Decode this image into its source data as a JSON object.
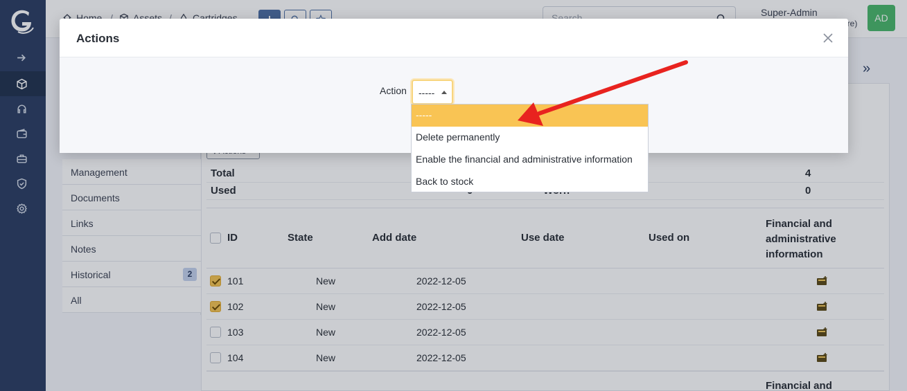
{
  "breadcrumb": {
    "home": "Home",
    "assets": "Assets",
    "cartridges": "Cartridges"
  },
  "search": {
    "placeholder": "Search"
  },
  "user": {
    "name": "Super-Admin",
    "entity": "ure)",
    "initials": "AD"
  },
  "tabs": [
    {
      "label": "Management"
    },
    {
      "label": "Documents"
    },
    {
      "label": "Links"
    },
    {
      "label": "Notes"
    },
    {
      "label": "Historical",
      "badge": "2"
    },
    {
      "label": "All"
    }
  ],
  "panel": {
    "actions_button": "Actions",
    "stats": [
      {
        "label": "Total",
        "mid": "",
        "right_label": "",
        "value": "4"
      },
      {
        "label": "Used",
        "mid": "0",
        "right_label": "Worn",
        "value": "0"
      }
    ],
    "table": {
      "headers": {
        "id": "ID",
        "state": "State",
        "add_date": "Add date",
        "use_date": "Use date",
        "used_on": "Used on",
        "financial": "Financial and administrative information"
      },
      "rows": [
        {
          "id": "101",
          "state": "New",
          "add_date": "2022-12-05",
          "checked": true
        },
        {
          "id": "102",
          "state": "New",
          "add_date": "2022-12-05",
          "checked": true
        },
        {
          "id": "103",
          "state": "New",
          "add_date": "2022-12-05",
          "checked": false
        },
        {
          "id": "104",
          "state": "New",
          "add_date": "2022-12-05",
          "checked": false
        }
      ],
      "footer_header": "Financial and"
    }
  },
  "modal": {
    "title": "Actions",
    "action_label": "Action",
    "selected_value": "-----",
    "options": [
      "-----",
      "Delete permanently",
      "Enable the financial and administrative information",
      "Back to stock"
    ]
  },
  "colors": {
    "sidebar": "#2c3e63",
    "accent": "#f9c454",
    "arrow": "#e8231f",
    "avatar": "#4bb86b"
  }
}
